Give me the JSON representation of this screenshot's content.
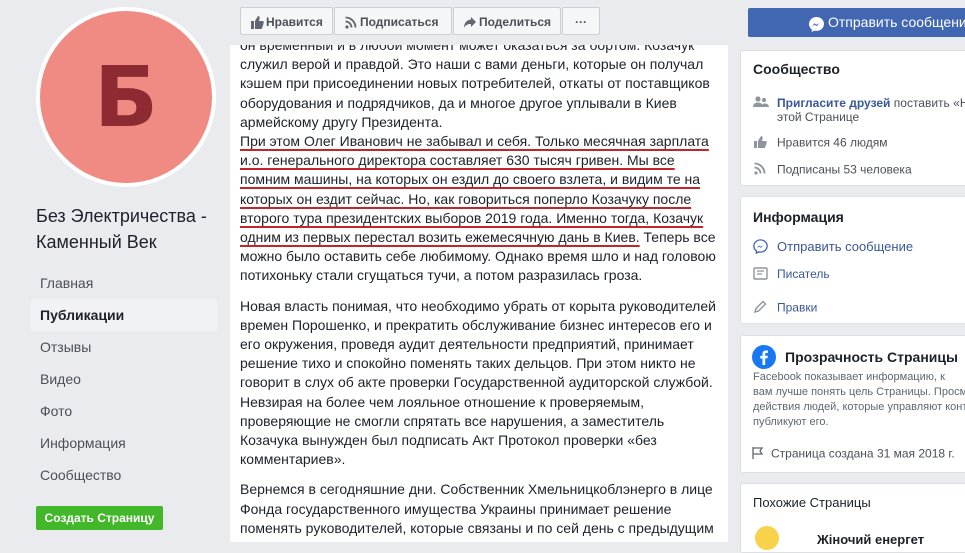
{
  "page": {
    "avatar_letter": "Б",
    "name": "Без Электричества - Каменный Век"
  },
  "nav": {
    "items": [
      {
        "label": "Главная"
      },
      {
        "label": "Публикации"
      },
      {
        "label": "Отзывы"
      },
      {
        "label": "Видео"
      },
      {
        "label": "Фото"
      },
      {
        "label": "Информация"
      },
      {
        "label": "Сообщество"
      }
    ],
    "create_label": "Создать Страницу"
  },
  "toolbar": {
    "like": "Нравится",
    "follow": "Подписаться",
    "share": "Поделиться",
    "more": "···",
    "send_message": "Отправить сообщение"
  },
  "post": {
    "p1_a": "он временный и в любой момент может оказаться за бортом. Козачук служил верой и правдой. Это наши с вами деньги, которые он получал кэшем при присоединении новых потребителей, откаты от поставщиков оборудования и подрядчиков, да и многое другое уплывали в Киев армейскому другу Президента.",
    "p1_u1": "При этом Олег Иванович не забывал и себя. Только месячная зарплата и.о. генерального директора составляет 630 тысяч гривен. Мы все помним машины, на которых он ездил до своего взлета, и видим те на которых он ездит сейчас. Но, как говориться поперло Козачуку после второго тура президентских выборов 2019 года. Именно тогда, Козачук одним из первых перестал возить ежемесячную дань в Киев.",
    "p1_b": " Теперь все можно было оставить себе любимому. Однако время шло и над головою потихоньку стали сгущаться тучи, а потом разразилась гроза.",
    "p2": "Новая власть понимая, что необходимо убрать от корыта руководителей времен Порошенко, и прекратить обслуживание бизнес интересов его и его окружения, проведя аудит деятельности предприятий, принимает решение тихо и спокойно поменять таких дельцов. При этом никто не говорит в слух об акте проверки Государственной аудиторской службой. Невзирая на более чем лояльное отношение к проверяемым, проверяющие не смогли спрятать все нарушения, а заместитель Козачука вынужден был подписать Акт Протокол проверки «без комментариев».",
    "p3": "Вернемся в сегодняшние дни. Собственник Хмельницкоблэнерго в лице Фонда государственного имущества Украины принимает решение поменять руководителей, которые связаны и по сей день с предыдущим режимом и допускают финансовые нарушения. И тут начинается самое"
  },
  "community": {
    "title": "Сообщество",
    "invite_link": "Пригласите друзей",
    "invite_rest": " поставить «Н",
    "invite_line2": "этой Странице",
    "likes": "Нравится 46 людям",
    "followers": "Подписаны 53 человека"
  },
  "info": {
    "title": "Информация",
    "send_message": "Отправить сообщение",
    "category": "Писатель",
    "edits": "Правки"
  },
  "transparency": {
    "title": "Прозрачность Страницы",
    "desc_1": "Facebook показывает информацию, к",
    "desc_2": "вам лучше понять цель Страницы. Просм",
    "desc_3": "действия людей, которые управляют конт",
    "desc_4": "публикуют его.",
    "created": "Страница создана 31 мая 2018 г."
  },
  "similar": {
    "title": "Похожие Страницы",
    "item1": "Жіночий енергет"
  },
  "colors": {
    "brand": "#4267b2",
    "create_green": "#42b72a",
    "avatar_bg": "#f08b84",
    "avatar_letter": "#8e2b32",
    "underline_red": "#c0272d"
  }
}
